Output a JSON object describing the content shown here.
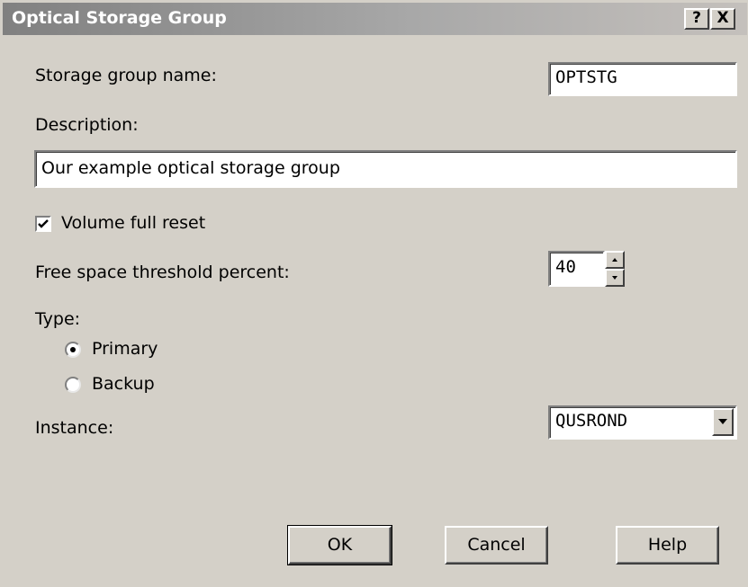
{
  "dialog": {
    "title": "Optical Storage Group",
    "help_button": "?",
    "close_button": "X"
  },
  "form": {
    "storage_group_label": "Storage group name:",
    "storage_group_value": "OPTSTG",
    "description_label": "Description:",
    "description_value": "Our example optical storage group",
    "volume_full_reset_label": "Volume full reset",
    "volume_full_reset_checked": true,
    "free_space_label": "Free space threshold percent:",
    "free_space_value": "40",
    "type_label": "Type:",
    "type_options": [
      {
        "label": "Primary",
        "selected": true
      },
      {
        "label": "Backup",
        "selected": false
      }
    ],
    "instance_label": "Instance:",
    "instance_value": "QUSROND"
  },
  "buttons": {
    "ok": "OK",
    "cancel": "Cancel",
    "help": "Help"
  },
  "colors": {
    "dialog_bg": "#d4d0c8",
    "title_text": "#ffffff",
    "title_gradient_start": "#808080",
    "field_bg": "#ffffff"
  }
}
